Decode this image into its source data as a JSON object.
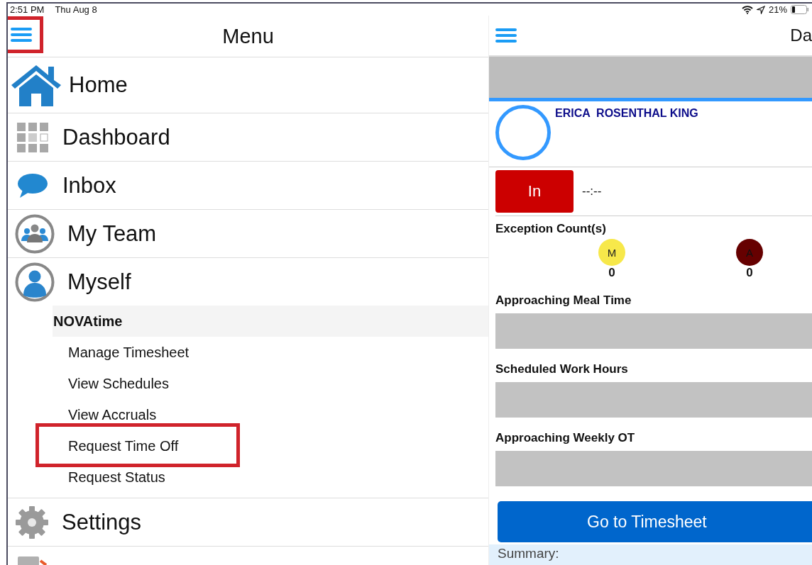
{
  "status_bar": {
    "time": "2:51 PM",
    "date": "Thu Aug 8",
    "battery": "21%"
  },
  "menu": {
    "title": "Menu",
    "menu_button_highlighted": true,
    "items": [
      {
        "label": "Home",
        "kind": "home"
      },
      {
        "label": "Dashboard",
        "kind": "dashboard"
      },
      {
        "label": "Inbox",
        "kind": "inbox"
      },
      {
        "label": "My Team",
        "kind": "team"
      },
      {
        "label": "Myself",
        "kind": "person",
        "section": "NOVAtime",
        "children": [
          {
            "label": "Manage Timesheet",
            "highlighted": false
          },
          {
            "label": "View Schedules",
            "highlighted": false
          },
          {
            "label": "View Accruals",
            "highlighted": false
          },
          {
            "label": "Request Time Off",
            "highlighted": true
          },
          {
            "label": "Request Status",
            "highlighted": false
          }
        ]
      },
      {
        "label": "Settings",
        "kind": "settings"
      },
      {
        "kind": "logout"
      }
    ]
  },
  "dashboard": {
    "title": "Da",
    "employee_name": "ERICA  ROSENTHAL KING",
    "punch_button": "In",
    "punch_time": "--:--",
    "exceptions_title": "Exception Count(s)",
    "exceptions": [
      {
        "letter": "M",
        "count": "0",
        "color": "#f7e84a"
      },
      {
        "letter": "A",
        "count": "0",
        "color": "#660000"
      }
    ],
    "sections": [
      {
        "title": "Approaching Meal Time"
      },
      {
        "title": "Scheduled Work Hours"
      },
      {
        "title": "Approaching Weekly OT"
      }
    ],
    "timesheet_button": "Go to Timesheet",
    "summary": "Summary:"
  }
}
